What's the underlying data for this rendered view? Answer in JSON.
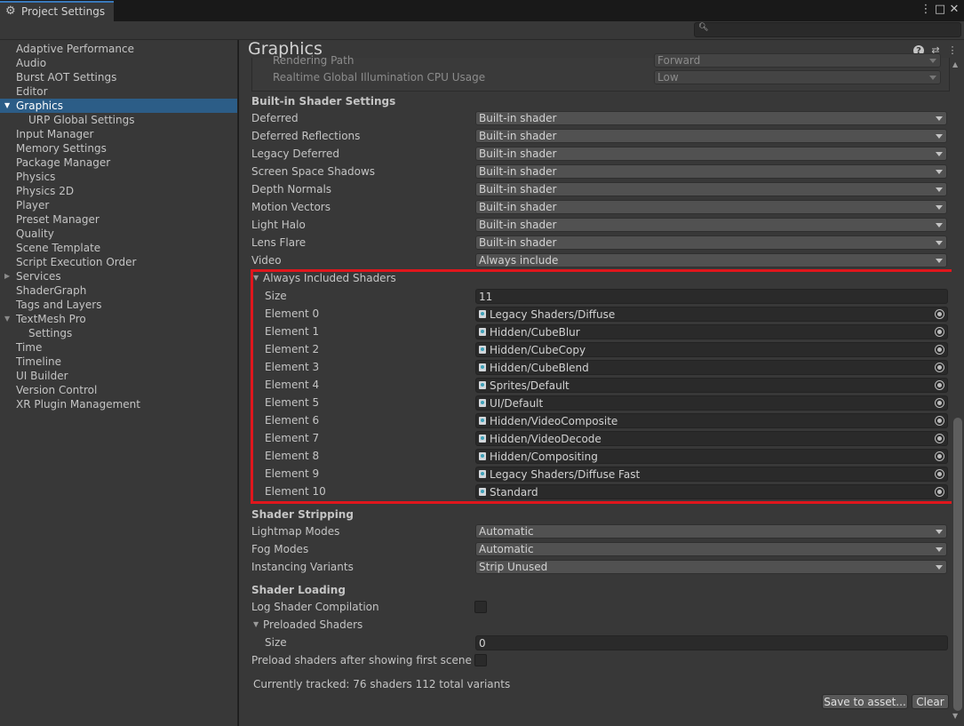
{
  "window": {
    "tab_title": "Project Settings",
    "tab_icon": "gear-icon"
  },
  "search": {
    "placeholder": ""
  },
  "sidebar": {
    "items": [
      {
        "label": "Adaptive Performance",
        "indent": 0,
        "selected": false,
        "foldout": ""
      },
      {
        "label": "Audio",
        "indent": 0,
        "selected": false,
        "foldout": ""
      },
      {
        "label": "Burst AOT Settings",
        "indent": 0,
        "selected": false,
        "foldout": ""
      },
      {
        "label": "Editor",
        "indent": 0,
        "selected": false,
        "foldout": ""
      },
      {
        "label": "Graphics",
        "indent": 0,
        "selected": true,
        "foldout": "open"
      },
      {
        "label": "URP Global Settings",
        "indent": 1,
        "selected": false,
        "foldout": ""
      },
      {
        "label": "Input Manager",
        "indent": 0,
        "selected": false,
        "foldout": ""
      },
      {
        "label": "Memory Settings",
        "indent": 0,
        "selected": false,
        "foldout": ""
      },
      {
        "label": "Package Manager",
        "indent": 0,
        "selected": false,
        "foldout": ""
      },
      {
        "label": "Physics",
        "indent": 0,
        "selected": false,
        "foldout": ""
      },
      {
        "label": "Physics 2D",
        "indent": 0,
        "selected": false,
        "foldout": ""
      },
      {
        "label": "Player",
        "indent": 0,
        "selected": false,
        "foldout": ""
      },
      {
        "label": "Preset Manager",
        "indent": 0,
        "selected": false,
        "foldout": ""
      },
      {
        "label": "Quality",
        "indent": 0,
        "selected": false,
        "foldout": ""
      },
      {
        "label": "Scene Template",
        "indent": 0,
        "selected": false,
        "foldout": ""
      },
      {
        "label": "Script Execution Order",
        "indent": 0,
        "selected": false,
        "foldout": ""
      },
      {
        "label": "Services",
        "indent": 0,
        "selected": false,
        "foldout": "closed"
      },
      {
        "label": "ShaderGraph",
        "indent": 0,
        "selected": false,
        "foldout": ""
      },
      {
        "label": "Tags and Layers",
        "indent": 0,
        "selected": false,
        "foldout": ""
      },
      {
        "label": "TextMesh Pro",
        "indent": 0,
        "selected": false,
        "foldout": "open"
      },
      {
        "label": "Settings",
        "indent": 1,
        "selected": false,
        "foldout": ""
      },
      {
        "label": "Time",
        "indent": 0,
        "selected": false,
        "foldout": ""
      },
      {
        "label": "Timeline",
        "indent": 0,
        "selected": false,
        "foldout": ""
      },
      {
        "label": "UI Builder",
        "indent": 0,
        "selected": false,
        "foldout": ""
      },
      {
        "label": "Version Control",
        "indent": 0,
        "selected": false,
        "foldout": ""
      },
      {
        "label": "XR Plugin Management",
        "indent": 0,
        "selected": false,
        "foldout": ""
      }
    ]
  },
  "page": {
    "title": "Graphics"
  },
  "previous_section": {
    "rows": [
      {
        "label": "Rendering Path",
        "value": "Forward"
      },
      {
        "label": "Realtime Global Illumination CPU Usage",
        "value": "Low"
      }
    ]
  },
  "builtin_shader_settings": {
    "title": "Built-in Shader Settings",
    "rows": [
      {
        "label": "Deferred",
        "value": "Built-in shader"
      },
      {
        "label": "Deferred Reflections",
        "value": "Built-in shader"
      },
      {
        "label": "Legacy Deferred",
        "value": "Built-in shader"
      },
      {
        "label": "Screen Space Shadows",
        "value": "Built-in shader"
      },
      {
        "label": "Depth Normals",
        "value": "Built-in shader"
      },
      {
        "label": "Motion Vectors",
        "value": "Built-in shader"
      },
      {
        "label": "Light Halo",
        "value": "Built-in shader"
      },
      {
        "label": "Lens Flare",
        "value": "Built-in shader"
      },
      {
        "label": "Video",
        "value": "Always include"
      }
    ]
  },
  "always_included": {
    "title": "Always Included Shaders",
    "size_label": "Size",
    "size_value": "11",
    "elements": [
      {
        "label": "Element 0",
        "value": "Legacy Shaders/Diffuse"
      },
      {
        "label": "Element 1",
        "value": "Hidden/CubeBlur"
      },
      {
        "label": "Element 2",
        "value": "Hidden/CubeCopy"
      },
      {
        "label": "Element 3",
        "value": "Hidden/CubeBlend"
      },
      {
        "label": "Element 4",
        "value": "Sprites/Default"
      },
      {
        "label": "Element 5",
        "value": "UI/Default"
      },
      {
        "label": "Element 6",
        "value": "Hidden/VideoComposite"
      },
      {
        "label": "Element 7",
        "value": "Hidden/VideoDecode"
      },
      {
        "label": "Element 8",
        "value": "Hidden/Compositing"
      },
      {
        "label": "Element 9",
        "value": "Legacy Shaders/Diffuse Fast"
      },
      {
        "label": "Element 10",
        "value": "Standard"
      }
    ]
  },
  "shader_stripping": {
    "title": "Shader Stripping",
    "rows": [
      {
        "label": "Lightmap Modes",
        "value": "Automatic"
      },
      {
        "label": "Fog Modes",
        "value": "Automatic"
      },
      {
        "label": "Instancing Variants",
        "value": "Strip Unused"
      }
    ]
  },
  "shader_loading": {
    "title": "Shader Loading",
    "log_label": "Log Shader Compilation",
    "preloaded_label": "Preloaded Shaders",
    "size_label": "Size",
    "size_value": "0",
    "preload_after_label": "Preload shaders after showing first scene"
  },
  "tracked_text": "Currently tracked: 76 shaders 112 total variants",
  "buttons": {
    "save": "Save to asset...",
    "clear": "Clear"
  },
  "colors": {
    "highlight_border": "#e0161c",
    "selection": "#2c5d87"
  }
}
